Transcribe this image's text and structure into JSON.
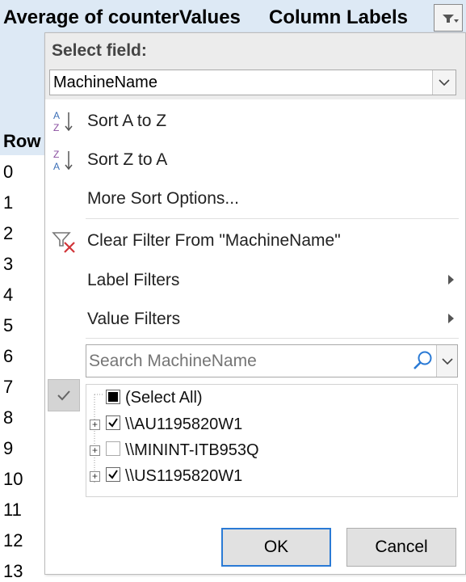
{
  "sheet": {
    "header_left": "Average of counterValues",
    "header_right": "Column Labels",
    "row_labels_head": "Row",
    "rows": [
      "0",
      "1",
      "2",
      "3",
      "4",
      "5",
      "6",
      "7",
      "8",
      "9",
      "10",
      "11",
      "12",
      "13"
    ]
  },
  "filter_panel": {
    "select_field_label": "Select field:",
    "field_value": "MachineName",
    "menu": {
      "sort_az": "Sort A to Z",
      "sort_za": "Sort Z to A",
      "more_sort": "More Sort Options...",
      "clear_filter": "Clear Filter From \"MachineName\"",
      "label_filters": "Label Filters",
      "value_filters": "Value Filters"
    },
    "search_placeholder": "Search MachineName",
    "items": [
      {
        "label": "(Select All)",
        "state": "partial"
      },
      {
        "label": "\\\\AU1195820W1",
        "state": "checked"
      },
      {
        "label": "\\\\MININT-ITB953Q",
        "state": "unchecked"
      },
      {
        "label": "\\\\US1195820W1",
        "state": "checked"
      }
    ],
    "ok_label": "OK",
    "cancel_label": "Cancel"
  },
  "colors": {
    "header_bg": "#dde9f5",
    "accent": "#2a7ad5",
    "clear_x": "#d13438",
    "sort_blue": "#3b6fb6",
    "sort_purple": "#8a4fa0"
  }
}
